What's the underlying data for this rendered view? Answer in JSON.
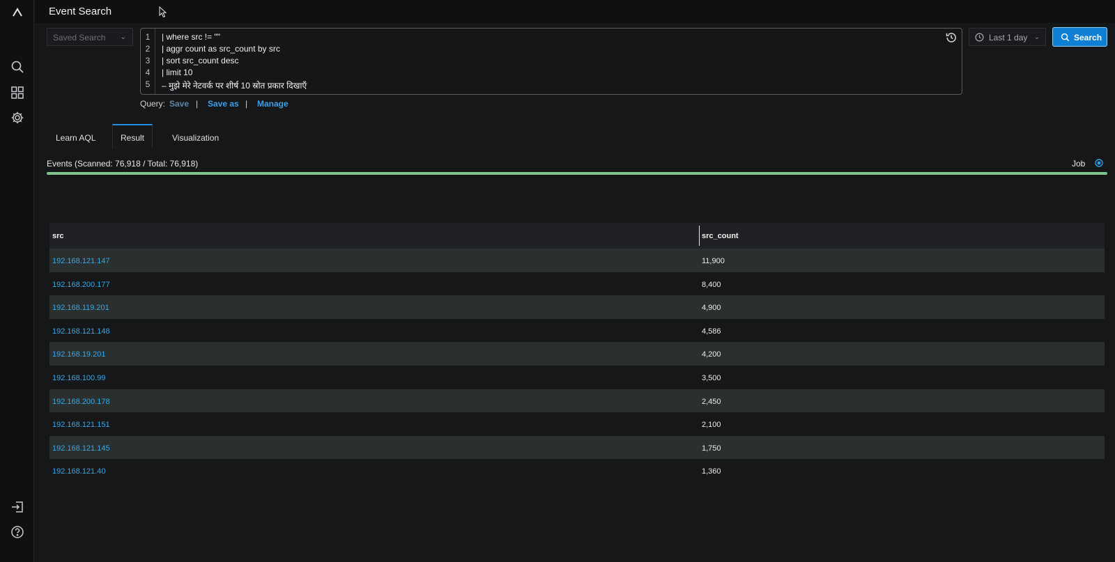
{
  "app": {
    "title": "Event Search"
  },
  "sidebar": {
    "items": [
      {
        "icon": "logo-caret-icon"
      },
      {
        "icon": "search-icon"
      },
      {
        "icon": "dashboard-grid-icon"
      },
      {
        "icon": "gear-icon"
      },
      {
        "icon": "logout-icon"
      },
      {
        "icon": "help-icon"
      }
    ]
  },
  "query_bar": {
    "saved_search_placeholder": "Saved Search",
    "lines": [
      {
        "num": "1",
        "text": "| where src != \"\""
      },
      {
        "num": "2",
        "text": "| aggr count as src_count by src"
      },
      {
        "num": "3",
        "text": "| sort src_count desc"
      },
      {
        "num": "4",
        "text": "| limit 10"
      },
      {
        "num": "5",
        "text": "–  मुझे मेरे नेटवर्क पर शीर्ष 10 स्रोत प्रकार दिखाएँ"
      }
    ],
    "time_range": "Last 1 day",
    "search_label": "Search"
  },
  "query_actions": {
    "label": "Query:",
    "save": "Save",
    "sep1": "|",
    "save_as": "Save as",
    "sep2": "|",
    "manage": "Manage"
  },
  "tabs": [
    {
      "label": "Learn AQL",
      "active": false
    },
    {
      "label": "Result",
      "active": true
    },
    {
      "label": "Visualization",
      "active": false
    }
  ],
  "status": {
    "events_text": "Events (Scanned: 76,918 / Total: 76,918)",
    "job_label": "Job",
    "progress": 1.0
  },
  "colors": {
    "accent": "#0e7fd2",
    "link": "#3aa7e6",
    "progress": "#7fc58a"
  },
  "table": {
    "columns": [
      "src",
      "src_count"
    ],
    "rows": [
      [
        "192.168.121.147",
        "11,900"
      ],
      [
        "192.168.200.177",
        "8,400"
      ],
      [
        "192.168.119.201",
        "4,900"
      ],
      [
        "192.168.121.148",
        "4,586"
      ],
      [
        "192.168.19.201",
        "4,200"
      ],
      [
        "192.168.100.99",
        "3,500"
      ],
      [
        "192.168.200.178",
        "2,450"
      ],
      [
        "192.168.121.151",
        "2,100"
      ],
      [
        "192.168.121.145",
        "1,750"
      ],
      [
        "192.168.121.40",
        "1,360"
      ]
    ]
  }
}
